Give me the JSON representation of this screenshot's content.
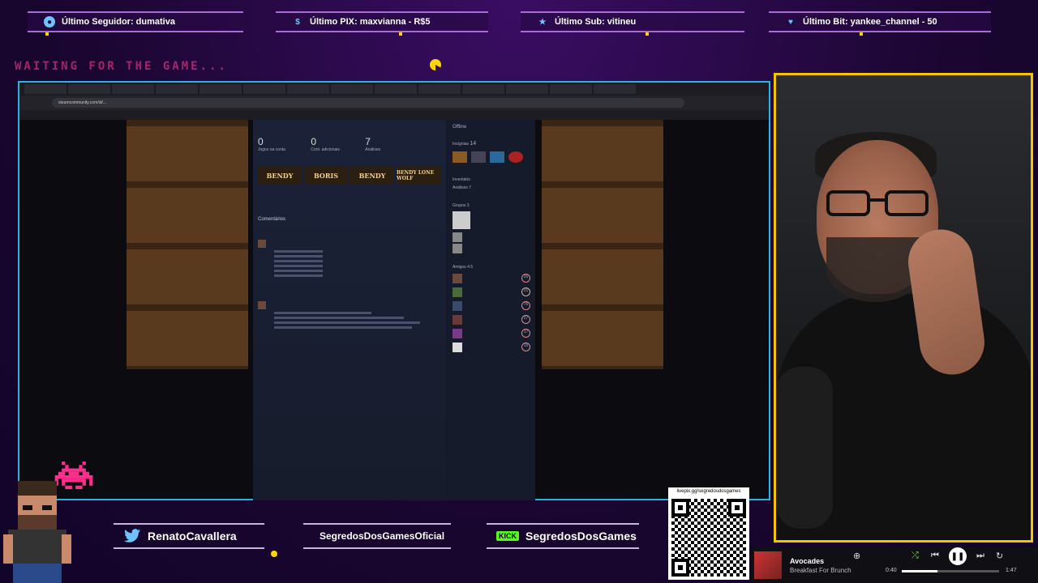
{
  "alerts": [
    {
      "label": "Último Seguidor: dumativa",
      "icon": "user-icon"
    },
    {
      "label": "Último PIX: maxvianna - R$5",
      "icon": "dollar-icon"
    },
    {
      "label": "Último Sub: vitineu",
      "icon": "star-icon"
    },
    {
      "label": "Último Bit: yankee_channel - 50",
      "icon": "heart-icon"
    }
  ],
  "waiting_text": "WAITING FOR THE GAME...",
  "browser": {
    "url": "steamcommunity.com/id/...",
    "stats": [
      {
        "value": "0",
        "label": "Jogos na conta"
      },
      {
        "value": "0",
        "label": "Cont. adicionais"
      },
      {
        "value": "7",
        "label": "Análises"
      }
    ],
    "games": [
      "BENDY",
      "BORIS",
      "BENDY",
      "BENDY LONE WOLF"
    ],
    "comments_header": "Comentários",
    "right_panel": {
      "status": "Offline",
      "badges_label": "Insígnias",
      "badges_count": "14",
      "inventory": "Inventário",
      "reviews": "Análises",
      "reviews_count": "7",
      "groups": "Grupos",
      "groups_count": "3",
      "friends": "Amigos",
      "friends_count": "4.5",
      "friend_levels": [
        "26",
        "31",
        "76",
        "27",
        "17",
        "15"
      ]
    }
  },
  "socials": {
    "twitter": "RenatoCavallera",
    "instagram": "SegredosDosGamesOficial",
    "kick_badge": "KICK",
    "kick": "SegredosDosGames"
  },
  "qr": {
    "label": "livepix.gg/segredosdosgames"
  },
  "player": {
    "title": "Avocades",
    "artist": "Breakfast For Brunch",
    "elapsed": "0:40",
    "duration": "1:47",
    "progress": 0.37
  }
}
